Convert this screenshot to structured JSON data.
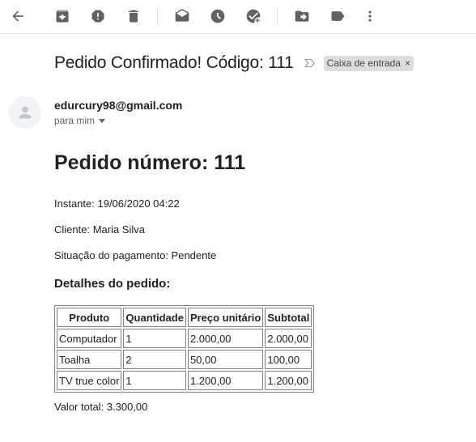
{
  "toolbar": {
    "buttons": [
      {
        "name": "back-icon"
      },
      {
        "name": "archive-icon"
      },
      {
        "name": "report-spam-icon"
      },
      {
        "name": "delete-icon"
      },
      {
        "name": "mark-as-unread-icon"
      },
      {
        "name": "snooze-icon"
      },
      {
        "name": "add-to-tasks-icon"
      },
      {
        "name": "move-to-icon"
      },
      {
        "name": "label-icon"
      },
      {
        "name": "more-options-icon"
      }
    ]
  },
  "email": {
    "subject": "Pedido Confirmado! Código: 111",
    "label": "Caixa de entrada",
    "label_close": "×",
    "sender": "edurcury98@gmail.com",
    "recipient": "para mim"
  },
  "order": {
    "title": "Pedido número: 111",
    "instant": "Instante: 19/06/2020 04:22",
    "client": "Cliente: Maria Silva",
    "payment_status": "Situação do pagamento: Pendente",
    "details_title": "Detalhes do pedido:",
    "table": {
      "headers": [
        "Produto",
        "Quantidade",
        "Preço unitário",
        "Subtotal"
      ],
      "rows": [
        [
          "Computador",
          "1",
          "2.000,00",
          "2.000,00"
        ],
        [
          "Toalha",
          "2",
          "50,00",
          "100,00"
        ],
        [
          "TV true color",
          "1",
          "1.200,00",
          "1.200,00"
        ]
      ]
    },
    "total": "Valor total: 3.300,00"
  },
  "colors": {
    "icon": "#5f6368",
    "important_marker": "#9aa0a6",
    "label_chip": "#dddddd"
  }
}
